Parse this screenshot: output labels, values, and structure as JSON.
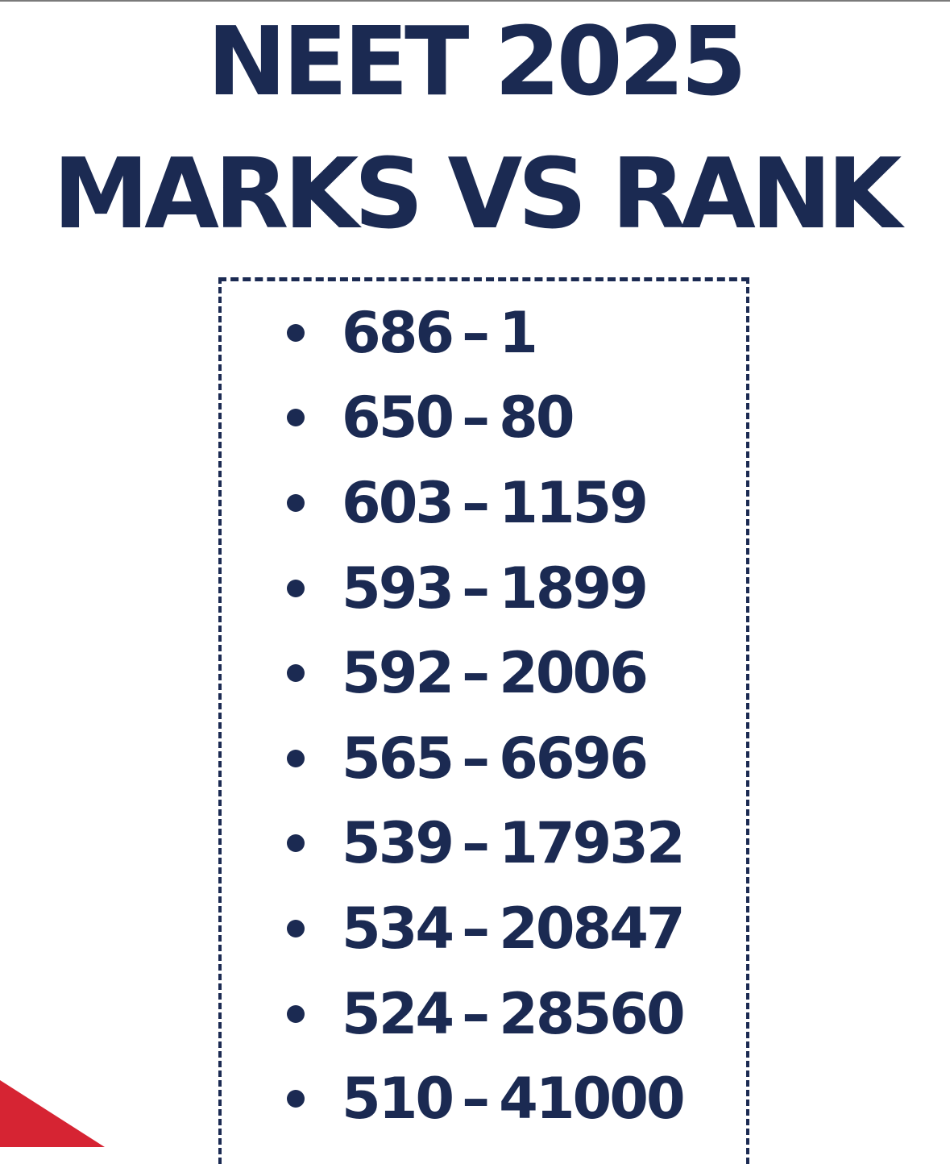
{
  "title": {
    "line1": "NEET 2025",
    "line2": "MARKS VS RANK"
  },
  "separator": "–",
  "entries": [
    {
      "marks": "686",
      "rank": "1"
    },
    {
      "marks": "650",
      "rank": "80"
    },
    {
      "marks": "603",
      "rank": "1159"
    },
    {
      "marks": "593",
      "rank": "1899"
    },
    {
      "marks": "592",
      "rank": "2006"
    },
    {
      "marks": "565",
      "rank": "6696"
    },
    {
      "marks": "539",
      "rank": "17932"
    },
    {
      "marks": "534",
      "rank": "20847"
    },
    {
      "marks": "524",
      "rank": "28560"
    },
    {
      "marks": "510",
      "rank": "41000"
    }
  ],
  "colors": {
    "text": "#1b2a52",
    "frame": "#1b2a52",
    "accent": "#d62433",
    "background": "#ffffff"
  },
  "icons": {
    "bullet": "bullet-dot-icon",
    "decoration": "red-triangle-decoration"
  }
}
